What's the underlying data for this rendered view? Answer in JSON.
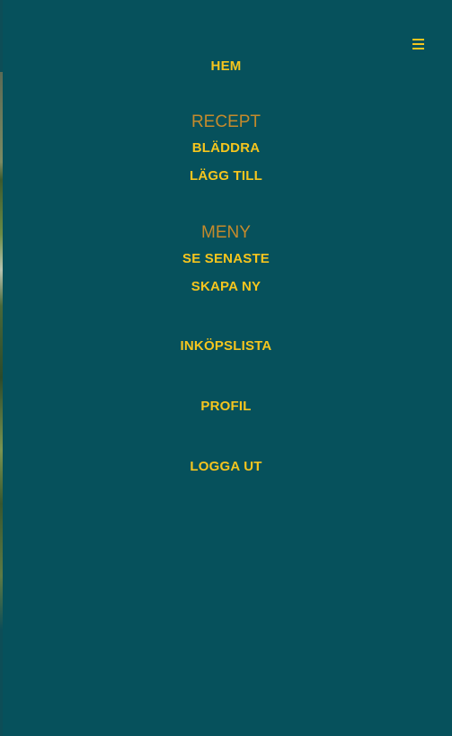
{
  "menu": {
    "toggle_icon": "hamburger-menu-icon",
    "link_color": "#f5c51e",
    "heading_color": "#c48a2c",
    "background_color": "#06515c",
    "home": "HEM",
    "recipes": {
      "heading": "RECEPT",
      "browse": "BLÄDDRA",
      "add": "LÄGG TILL"
    },
    "menus": {
      "heading": "MENY",
      "latest": "SE SENASTE",
      "create": "SKAPA NY"
    },
    "shopping_list": "INKÖPSLISTA",
    "profile": "PROFIL",
    "logout": "LOGGA UT"
  }
}
